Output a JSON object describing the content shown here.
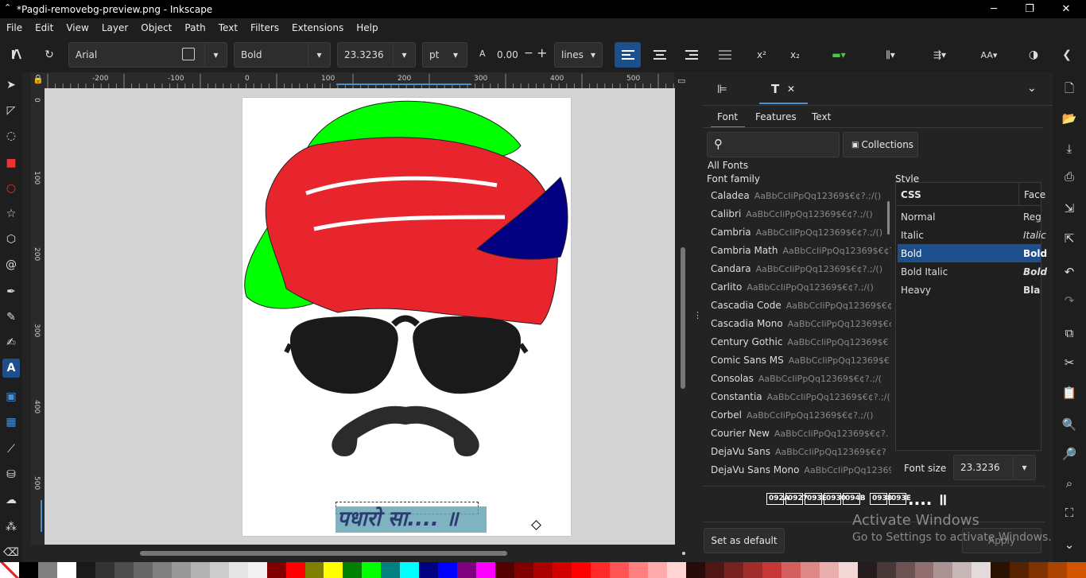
{
  "window": {
    "title": "*Pagdi-removebg-preview.png - Inkscape",
    "min": "─",
    "max": "❐",
    "close": "✕"
  },
  "menu": [
    "File",
    "Edit",
    "View",
    "Layer",
    "Object",
    "Path",
    "Text",
    "Filters",
    "Extensions",
    "Help"
  ],
  "toolbar": {
    "font_family": "Arial",
    "font_style": "Bold",
    "font_size": "23.3236",
    "unit": "pt",
    "line_spacing": "0.00",
    "spacing_unit": "lines",
    "icons": {
      "letter_spacing": "A",
      "minus": "−",
      "plus": "+",
      "superscript": "x²",
      "subscript": "x₂",
      "caps": "AA"
    }
  },
  "rulers": {
    "h_ticks": [
      "-200",
      "-100",
      "0",
      "100",
      "200",
      "300",
      "400",
      "500"
    ],
    "v_ticks": [
      "0",
      "100",
      "200",
      "300",
      "400",
      "500"
    ]
  },
  "canvas": {
    "text_object": "पधारो सा.... ॥",
    "colors": {
      "green": "#00ff00",
      "red": "#e8242c",
      "blue": "#020080",
      "black": "#1a1a1a"
    }
  },
  "panel": {
    "tab_icons": [
      "align-icon",
      "text-icon"
    ],
    "tab_close": "✕",
    "subtabs": [
      "Font",
      "Features",
      "Text"
    ],
    "search": {
      "placeholder": ""
    },
    "collections": "Collections",
    "all_fonts": "All Fonts",
    "font_family_label": "Font family",
    "style_label": "Style",
    "style_headers": [
      "CSS",
      "Face"
    ],
    "families": [
      {
        "name": "Caladea",
        "sample": "AaBbCcIiPpQq12369$€¢?.;/()"
      },
      {
        "name": "Calibri",
        "sample": "AaBbCcIiPpQq12369$€¢?.;/()"
      },
      {
        "name": "Cambria",
        "sample": "AaBbCcIiPpQq12369$€¢?.;/()"
      },
      {
        "name": "Cambria Math",
        "sample": "AaBbCcIiPpQq12369$€¢?.;/"
      },
      {
        "name": "Candara",
        "sample": "AaBbCcIiPpQq12369$€¢?.;/()"
      },
      {
        "name": "Carlito",
        "sample": "AaBbCcIiPpQq12369$€¢?.;/()"
      },
      {
        "name": "Cascadia Code",
        "sample": "AaBbCcIiPpQq12369$€¢"
      },
      {
        "name": "Cascadia Mono",
        "sample": "AaBbCcIiPpQq12369$€¢"
      },
      {
        "name": "Century Gothic",
        "sample": "AaBbCcIiPpQq12369$€"
      },
      {
        "name": "Comic Sans MS",
        "sample": "AaBbCcIiPpQq12369$€"
      },
      {
        "name": "Consolas",
        "sample": "AaBbCcIiPpQq12369$€¢?.;/("
      },
      {
        "name": "Constantia",
        "sample": "AaBbCcIiPpQq12369$€¢?.;/()"
      },
      {
        "name": "Corbel",
        "sample": "AaBbCcIiPpQq12369$€¢?.;/()"
      },
      {
        "name": "Courier New",
        "sample": "AaBbCcIiPpQq12369$€¢?."
      },
      {
        "name": "DejaVu Sans",
        "sample": "AaBbCcIiPpQq12369$€¢?"
      },
      {
        "name": "DejaVu Sans Mono",
        "sample": "AaBbCcIiPpQq12369"
      }
    ],
    "styles": [
      {
        "css": "Normal",
        "face": "Reg",
        "selected": false
      },
      {
        "css": "Italic",
        "face": "Italic",
        "selected": false
      },
      {
        "css": "Bold",
        "face": "Bold",
        "selected": true
      },
      {
        "css": "Bold Italic",
        "face": "Bold",
        "selected": false
      },
      {
        "css": "Heavy",
        "face": "Bla",
        "selected": false
      }
    ],
    "font_size_label": "Font size",
    "font_size": "23.3236",
    "preview_text": ".... ॥",
    "preview_boxes": [
      "092A",
      "0927",
      "093E",
      "0930",
      "094B",
      "0938",
      "093E"
    ],
    "set_default": "Set as default",
    "apply": "Apply"
  },
  "watermark": {
    "line1": "Activate Windows",
    "line2": "Go to Settings to activate Windows."
  },
  "palette": [
    "#ffffff",
    "#000000",
    "#808080",
    "#ffffff",
    "#1a1a1a",
    "#333333",
    "#4d4d4d",
    "#666666",
    "#808080",
    "#999999",
    "#b3b3b3",
    "#cccccc",
    "#e6e6e6",
    "#f2f2f2",
    "#800000",
    "#ff0000",
    "#808000",
    "#ffff00",
    "#008000",
    "#00ff00",
    "#008080",
    "#00ffff",
    "#000080",
    "#0000ff",
    "#800080",
    "#ff00ff",
    "#550000",
    "#800000",
    "#aa0000",
    "#d40000",
    "#ff0000",
    "#ff2a2a",
    "#ff5555",
    "#ff8080",
    "#ffaaaa",
    "#ffd5d5",
    "#280b0b",
    "#501616",
    "#782121",
    "#a02c2c",
    "#c83737",
    "#d35f5f",
    "#de8787",
    "#e9afaf",
    "#f4d7d7",
    "#241c1c",
    "#483737",
    "#6c5353",
    "#916f6f",
    "#ac9393",
    "#c8b7b7",
    "#e3dbdb",
    "#2b1100",
    "#552200",
    "#803300",
    "#aa4400",
    "#d45500"
  ]
}
